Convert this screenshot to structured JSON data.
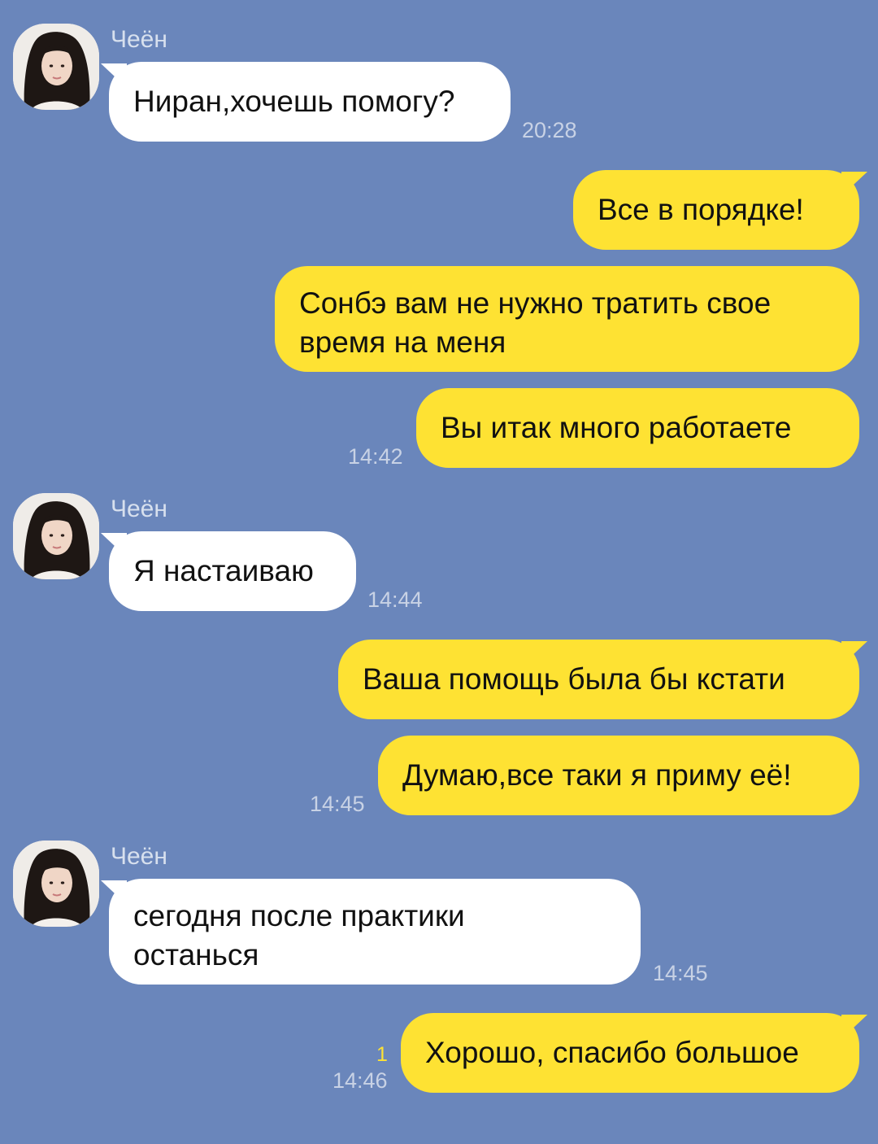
{
  "contact": {
    "name": "Чеён"
  },
  "colors": {
    "background": "#6a86bb",
    "incoming_bubble": "#ffffff",
    "outgoing_bubble": "#fee233",
    "time_text": "#c8d2e5",
    "unread_count": "#fee233"
  },
  "messages": [
    {
      "id": "m1",
      "from": "Чеён",
      "text": "Ниран,хочешь помогу?",
      "time": "20:28"
    },
    {
      "id": "m2",
      "from": "me",
      "text": "Все в порядке!"
    },
    {
      "id": "m3",
      "from": "me",
      "text": "Сонбэ вам не нужно тратить свое время на меня"
    },
    {
      "id": "m4",
      "from": "me",
      "text": "Вы итак много работаете",
      "time": "14:42"
    },
    {
      "id": "m5",
      "from": "Чеён",
      "text": "Я настаиваю",
      "time": "14:44"
    },
    {
      "id": "m6",
      "from": "me",
      "text": "Ваша помощь была бы кстати"
    },
    {
      "id": "m7",
      "from": "me",
      "text": "Думаю,все таки я приму её!",
      "time": "14:45"
    },
    {
      "id": "m8",
      "from": "Чеён",
      "text": "сегодня после практики останься",
      "time": "14:45"
    },
    {
      "id": "m9",
      "from": "me",
      "text": "Хорошо, спасибо большое",
      "time": "14:46",
      "unread": "1"
    }
  ]
}
